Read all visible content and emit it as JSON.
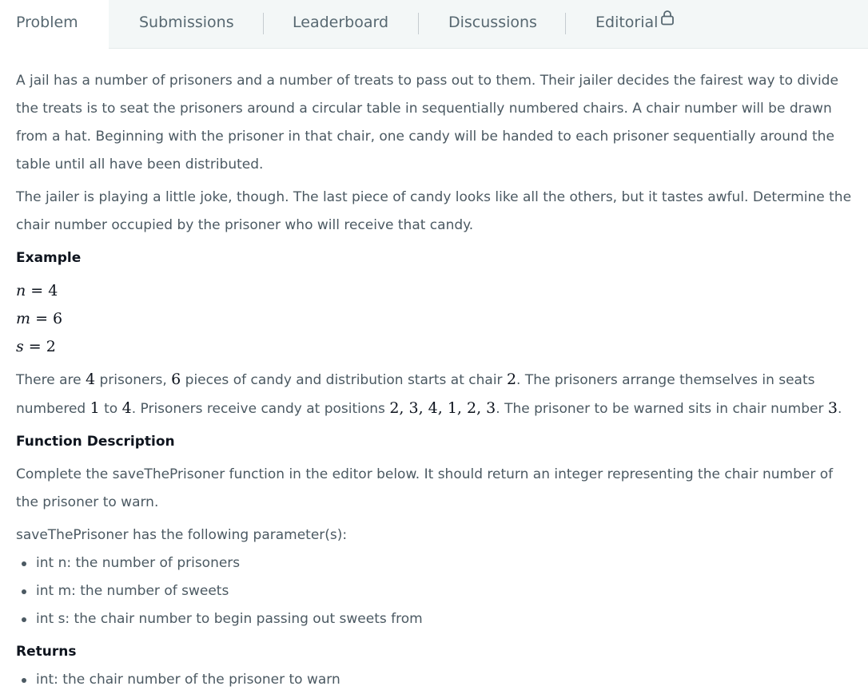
{
  "tabs": {
    "problem": "Problem",
    "submissions": "Submissions",
    "leaderboard": "Leaderboard",
    "discussions": "Discussions",
    "editorial": "Editorial"
  },
  "problem": {
    "intro_1": "A jail has a number of prisoners and a number of treats to pass out to them. Their jailer decides the fairest way to divide the treats is to seat the prisoners around a circular table in sequentially numbered chairs. A chair number will be drawn from a hat. Beginning with the prisoner in that chair, one candy will be handed to each prisoner sequentially around the table until all have been distributed.",
    "intro_2": "The jailer is playing a little joke, though. The last piece of candy looks like all the others, but it tastes awful. Determine the chair number occupied by the prisoner who will receive that candy.",
    "example_heading": "Example",
    "example_vars": [
      {
        "name": "n",
        "value": "4"
      },
      {
        "name": "m",
        "value": "6"
      },
      {
        "name": "s",
        "value": "2"
      }
    ],
    "example_text": {
      "t1": "There are ",
      "v1": "4",
      "t2": " prisoners, ",
      "v2": "6",
      "t3": " pieces of candy and distribution starts at chair ",
      "v3": "2",
      "t4": ". The prisoners arrange themselves in seats numbered ",
      "v4": "1",
      "t5": " to ",
      "v5": "4",
      "t6": ". Prisoners receive candy at positions ",
      "v6": "2, 3, 4, 1, 2, 3",
      "t7": ". The prisoner to be warned sits in chair number ",
      "v7": "3",
      "t8": "."
    },
    "function_heading": "Function Description",
    "function_desc": "Complete the saveThePrisoner function in the editor below. It should return an integer representing the chair number of the prisoner to warn.",
    "params_intro": "saveThePrisoner has the following parameter(s):",
    "params": [
      "int n: the number of prisoners",
      "int m: the number of sweets",
      "int s: the chair number to begin passing out sweets from"
    ],
    "returns_heading": "Returns",
    "returns": [
      "int: the chair number of the prisoner to warn"
    ]
  }
}
